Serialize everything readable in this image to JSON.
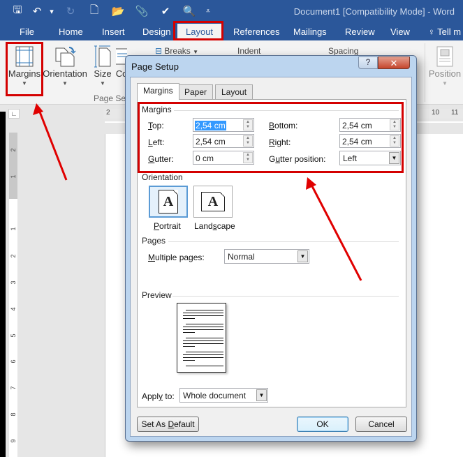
{
  "window": {
    "title": "Document1 [Compatibility Mode] - Word"
  },
  "quick_access": [
    {
      "icon": "save-icon",
      "glyph": "🖫"
    },
    {
      "icon": "undo-icon",
      "glyph": "↶"
    },
    {
      "icon": "undo-dropdown-icon",
      "glyph": "▾"
    },
    {
      "icon": "redo-icon",
      "glyph": "↻"
    },
    {
      "icon": "new-document-icon",
      "glyph": "🗋"
    },
    {
      "icon": "open-folder-icon",
      "glyph": "📂"
    },
    {
      "icon": "attach-icon",
      "glyph": "📎"
    },
    {
      "icon": "check-icon",
      "glyph": "✔"
    },
    {
      "icon": "print-preview-icon",
      "glyph": "🔍"
    },
    {
      "icon": "customize-qat-icon",
      "glyph": "⩡"
    }
  ],
  "tabs": [
    "File",
    "Home",
    "Insert",
    "Design",
    "Layout",
    "References",
    "Mailings",
    "Review",
    "View"
  ],
  "active_tab": "Layout",
  "tell_me": "Tell m",
  "ribbon": {
    "margins": "Margins",
    "orientation": "Orientation",
    "size": "Size",
    "columns_partial": "Co",
    "breaks": "Breaks",
    "indent": "Indent",
    "spacing": "Spacing",
    "position": "Position",
    "group_page_setup": "Page Setup"
  },
  "ruler": {
    "h_labels": [
      "2",
      "10",
      "11"
    ],
    "v_labels": [
      "2",
      "1",
      "1",
      "2",
      "3",
      "4",
      "5",
      "6",
      "7",
      "8",
      "9"
    ]
  },
  "dialog": {
    "title": "Page Setup",
    "help": "?",
    "close": "✕",
    "tabs": [
      "Margins",
      "Paper",
      "Layout"
    ],
    "active_tab": "Margins",
    "margins_section": "Margins",
    "fields": {
      "top": {
        "label_pre": "",
        "label_u": "T",
        "label_post": "op:",
        "value": "2,54 cm"
      },
      "bottom": {
        "label_pre": "",
        "label_u": "B",
        "label_post": "ottom:",
        "value": "2,54 cm"
      },
      "left": {
        "label_pre": "",
        "label_u": "L",
        "label_post": "eft:",
        "value": "2,54 cm"
      },
      "right": {
        "label_pre": "",
        "label_u": "R",
        "label_post": "ight:",
        "value": "2,54 cm"
      },
      "gutter": {
        "label_pre": "",
        "label_u": "G",
        "label_post": "utter:",
        "value": "0 cm"
      },
      "gutter_position": {
        "label_pre": "G",
        "label_u": "u",
        "label_post": "tter position:",
        "value": "Left"
      }
    },
    "orientation_section": "Orientation",
    "orientation": {
      "portrait": {
        "pre": "",
        "u": "P",
        "post": "ortrait",
        "glyph": "A"
      },
      "landscape": {
        "pre": "Land",
        "u": "s",
        "post": "cape",
        "glyph": "A"
      },
      "selected": "Portrait"
    },
    "pages_section": "Pages",
    "multiple_pages": {
      "pre": "",
      "u": "M",
      "post": "ultiple pages:",
      "value": "Normal"
    },
    "preview_section": "Preview",
    "apply_to": {
      "pre": "Appl",
      "u": "y",
      "post": " to:",
      "value": "Whole document"
    },
    "buttons": {
      "set_default": {
        "pre": "Set As ",
        "u": "D",
        "post": "efault"
      },
      "ok": "OK",
      "cancel": "Cancel"
    }
  },
  "annotations": {
    "highlight_color": "#d40000"
  }
}
